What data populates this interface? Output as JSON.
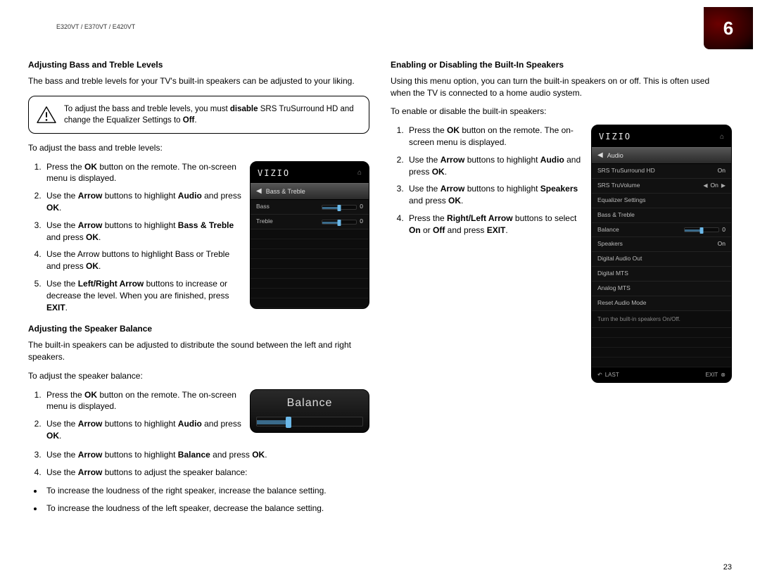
{
  "header_model": "E320VT / E370VT / E420VT",
  "chapter_number": "6",
  "page_number": "23",
  "left": {
    "h1": "Adjusting Bass and Treble Levels",
    "p1": "The bass and treble levels for your TV's built-in speakers can be adjusted to your liking.",
    "warning_prefix": "To adjust the bass and treble levels, you must ",
    "warning_bold": "disable",
    "warning_suffix": " SRS TruSurround HD and change the Equalizer Settings to ",
    "warning_bold2": "Off",
    "warning_end": ".",
    "p2": "To adjust the bass and treble levels:",
    "steps1": [
      {
        "pre": "Press the ",
        "b": "OK",
        "post": " button on the remote. The on-screen menu is displayed."
      },
      {
        "pre": "Use the ",
        "b": "Arrow",
        "post": " buttons to highlight ",
        "b2": "Audio",
        "post2": " and press ",
        "b3": "OK",
        "post3": "."
      },
      {
        "pre": "Use the ",
        "b": "Arrow",
        "post": " buttons to highlight ",
        "b2": "Bass & Treble",
        "post2": " and press ",
        "b3": "OK",
        "post3": "."
      },
      {
        "pre": "Use the Arrow buttons to highlight Bass or Treble and press ",
        "b": "OK",
        "post": "."
      },
      {
        "pre": "Use the ",
        "b": "Left/Right Arrow",
        "post": " buttons to increase or decrease the level. When you are finished, press ",
        "b2": "EXIT",
        "post2": "."
      }
    ],
    "h2": "Adjusting the Speaker Balance",
    "p3": "The built-in speakers can be adjusted to distribute the sound between the left and right speakers.",
    "p4": "To adjust the speaker balance:",
    "steps2": [
      {
        "pre": "Press the ",
        "b": "OK",
        "post": " button on the remote. The on-screen menu is displayed."
      },
      {
        "pre": "Use the ",
        "b": "Arrow",
        "post": " buttons to highlight ",
        "b2": "Audio",
        "post2": " and press ",
        "b3": "OK",
        "post3": "."
      },
      {
        "pre": "Use the ",
        "b": "Arrow",
        "post": " buttons to highlight ",
        "b2": "Balance",
        "post2": " and press ",
        "b3": "OK",
        "post3": "."
      },
      {
        "pre": "Use the ",
        "b": "Arrow",
        "post": " buttons to adjust the speaker balance:"
      }
    ],
    "bullets": [
      "To increase the loudness of the right speaker, increase the balance setting.",
      "To increase the loudness of the left speaker, decrease the balance setting."
    ]
  },
  "right": {
    "h1": "Enabling or Disabling the Built-In Speakers",
    "p1": "Using this menu option, you can turn the built-in speakers on or off. This is often used when the TV is connected to a home audio system.",
    "p2": "To enable or disable the built-in speakers:",
    "steps": [
      {
        "pre": "Press the ",
        "b": "OK",
        "post": " button on the remote. The on-screen menu is displayed."
      },
      {
        "pre": "Use the ",
        "b": "Arrow",
        "post": " buttons to highlight ",
        "b2": "Audio",
        "post2": " and press ",
        "b3": "OK",
        "post3": "."
      },
      {
        "pre": "Use the ",
        "b": "Arrow",
        "post": " buttons to highlight ",
        "b2": "Speakers",
        "post2": " and press ",
        "b3": "OK",
        "post3": "."
      },
      {
        "pre": "Press the ",
        "b": "Right/Left Arrow",
        "post": " buttons to select ",
        "b2": "On",
        "post2": " or ",
        "b3": "Off",
        "post3": " and press ",
        "b4": "EXIT",
        "post4": "."
      }
    ]
  },
  "tv1": {
    "logo": "VIZIO",
    "crumb": "Bass & Treble",
    "rows": [
      {
        "label": "Bass",
        "val": "0"
      },
      {
        "label": "Treble",
        "val": "0"
      }
    ]
  },
  "tv2": {
    "title": "Balance"
  },
  "tv3": {
    "logo": "VIZIO",
    "crumb": "Audio",
    "rows": [
      {
        "label": "SRS TruSurround HD",
        "val": "On"
      },
      {
        "label": "SRS TruVolume",
        "val": "On",
        "arrow": true
      },
      {
        "label": "Equalizer Settings",
        "val": ""
      },
      {
        "label": "Bass & Treble",
        "val": ""
      },
      {
        "label": "Balance",
        "val": "0",
        "slider": true
      },
      {
        "label": "Speakers",
        "val": "On"
      },
      {
        "label": "Digital Audio Out",
        "val": ""
      },
      {
        "label": "Digital MTS",
        "val": ""
      },
      {
        "label": "Analog MTS",
        "val": ""
      },
      {
        "label": "Reset Audio Mode",
        "val": ""
      }
    ],
    "note": "Turn the built-in speakers On/Off.",
    "footer_left": "LAST",
    "footer_right": "EXIT"
  }
}
